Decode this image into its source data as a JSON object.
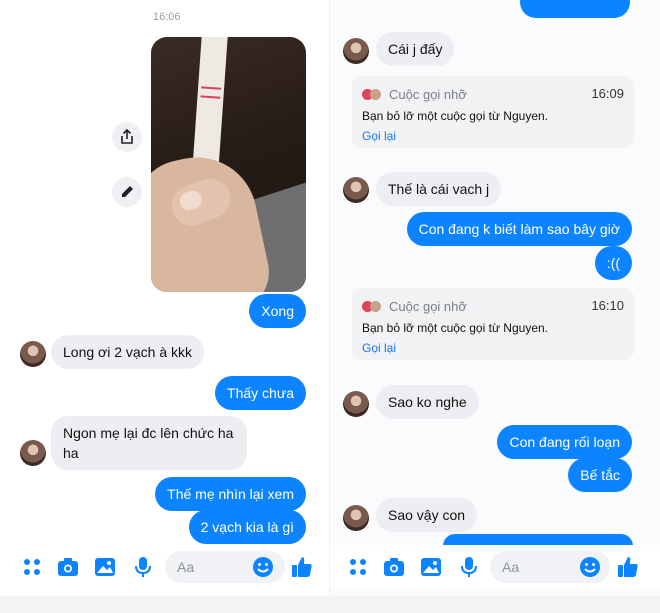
{
  "colors": {
    "accent": "#0d84ff",
    "incoming": "#eceef1",
    "link": "#1877f2"
  },
  "left": {
    "timestamp": "16:06",
    "side_icons": [
      "share-icon",
      "edit-icon"
    ],
    "messages": [
      {
        "type": "out",
        "text": "Xong"
      },
      {
        "type": "in",
        "text": "Long ơi 2 vạch à kkk"
      },
      {
        "type": "out",
        "text": "Thấy chưa"
      },
      {
        "type": "in",
        "text": "Ngon mẹ lại đc lên chức ha\nha"
      },
      {
        "type": "out",
        "text": "Thế mẹ nhìn lại xem"
      },
      {
        "type": "out",
        "text": "2 vạch kia là gì"
      }
    ],
    "composer": {
      "placeholder": "Aa"
    }
  },
  "right": {
    "messages": [
      {
        "type": "in",
        "text": "Cái j đấy"
      },
      {
        "type": "call",
        "title": "Cuộc gọi nhỡ",
        "time": "16:09",
        "desc": "Bạn bỏ lỡ một cuộc gọi từ Nguyen.",
        "action": "Gọi lại"
      },
      {
        "type": "in",
        "text": "Thế là cái vach j"
      },
      {
        "type": "out",
        "text": "Con đang k biết làm sao bây giờ"
      },
      {
        "type": "out",
        "text": ":(("
      },
      {
        "type": "call",
        "title": "Cuộc gọi nhỡ",
        "time": "16:10",
        "desc": "Bạn bỏ lỡ một cuộc gọi từ Nguyen.",
        "action": "Gọi lại"
      },
      {
        "type": "in",
        "text": "Sao ko nghe"
      },
      {
        "type": "out",
        "text": "Con đang rối loạn"
      },
      {
        "type": "out",
        "text": "Bế tắc"
      },
      {
        "type": "in",
        "text": "Sao vậy con"
      }
    ],
    "composer": {
      "placeholder": "Aa"
    }
  },
  "composer_icons": [
    "apps-icon",
    "camera-icon",
    "image-icon",
    "microphone-icon",
    "emoji-icon",
    "thumbs-up-icon"
  ]
}
